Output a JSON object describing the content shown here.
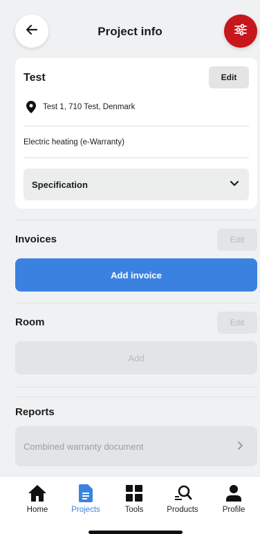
{
  "header": {
    "title": "Project info",
    "back_icon": "arrow-left-icon",
    "filter_icon": "sliders-icon",
    "accent_color": "#c8161d"
  },
  "project": {
    "name": "Test",
    "edit_label": "Edit",
    "address": "Test 1, 710 Test, Denmark",
    "product": "Electric heating (e-Warranty)",
    "specification_label": "Specification"
  },
  "invoices": {
    "title": "Invoices",
    "edit_label": "Edit",
    "add_label": "Add invoice",
    "button_color": "#3b82e0"
  },
  "room": {
    "title": "Room",
    "edit_label": "Edit",
    "add_label": "Add"
  },
  "reports": {
    "title": "Reports",
    "item_label": "Combined warranty document"
  },
  "nav": {
    "items": [
      {
        "label": "Home",
        "icon": "home-icon"
      },
      {
        "label": "Projects",
        "icon": "document-icon",
        "active": true
      },
      {
        "label": "Tools",
        "icon": "grid-icon"
      },
      {
        "label": "Products",
        "icon": "product-search-icon"
      },
      {
        "label": "Profile",
        "icon": "person-icon"
      }
    ]
  }
}
